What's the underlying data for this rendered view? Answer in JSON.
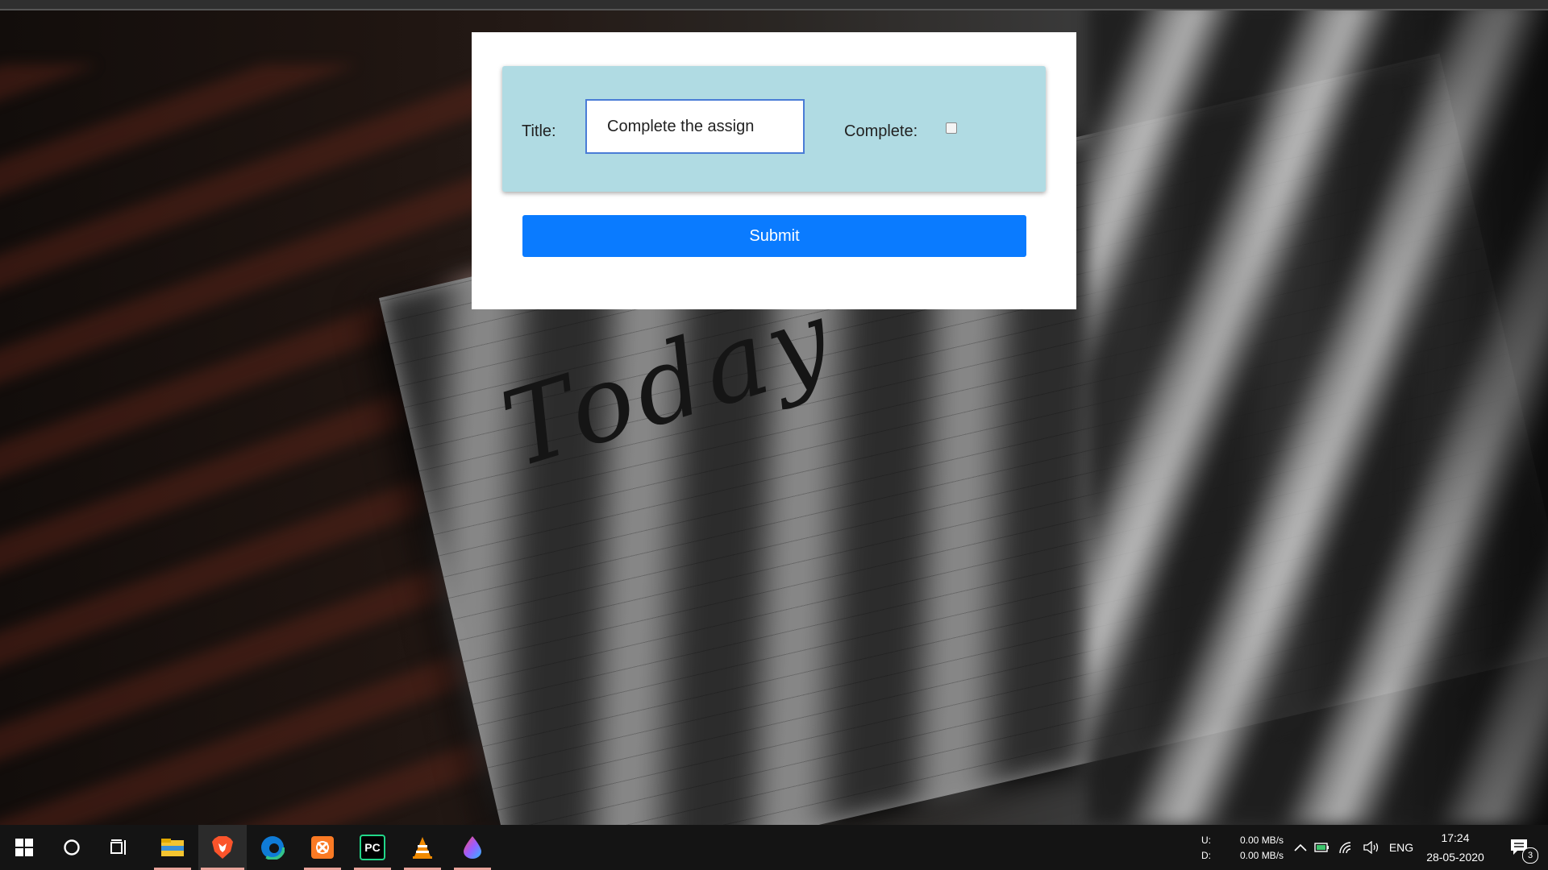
{
  "form": {
    "title_label": "Title:",
    "title_value": "Complete the assign",
    "complete_label": "Complete:",
    "complete_checked": false,
    "submit_label": "Submit"
  },
  "wallpaper": {
    "handwriting": "Today"
  },
  "taskbar": {
    "apps": [
      {
        "name": "file-explorer-icon"
      },
      {
        "name": "brave-browser-icon",
        "active": true
      },
      {
        "name": "edge-browser-icon"
      },
      {
        "name": "xampp-icon"
      },
      {
        "name": "pycharm-icon",
        "text": "PC"
      },
      {
        "name": "vlc-icon"
      },
      {
        "name": "color-app-icon"
      }
    ],
    "net_up_label": "U:",
    "net_down_label": "D:",
    "net_up_value": "0.00 MB/s",
    "net_down_value": "0.00 MB/s",
    "language": "ENG",
    "time": "17:24",
    "date": "28-05-2020",
    "notification_count": "3"
  },
  "colors": {
    "panel": "#b0dbe3",
    "submit": "#0a7bff",
    "input_border": "#4a7cd6"
  }
}
